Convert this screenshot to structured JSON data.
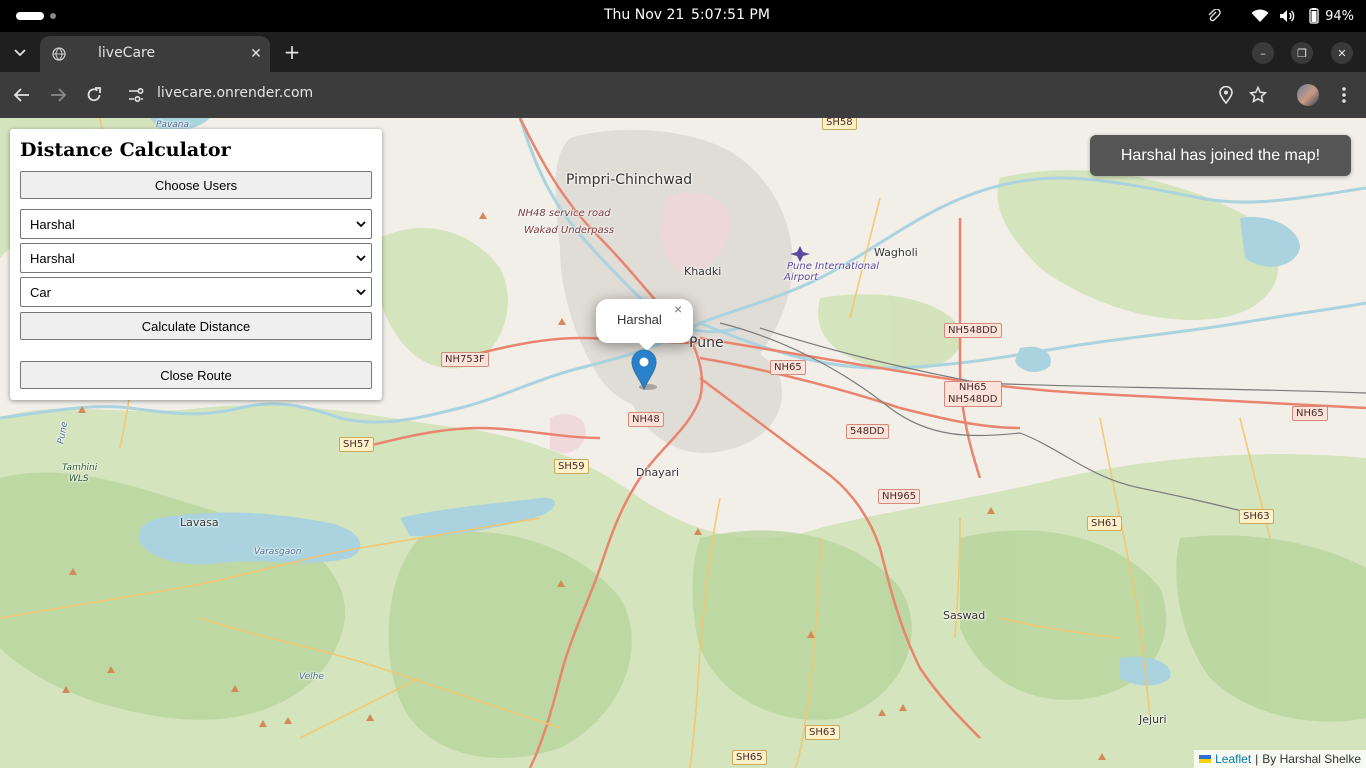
{
  "os": {
    "date": "Thu Nov 21",
    "time": "5:07:51 PM",
    "battery": "94%"
  },
  "browser": {
    "tab_title": "liveCare",
    "url": "livecare.onrender.com"
  },
  "panel": {
    "title": "Distance Calculator",
    "choose_users_label": "Choose Users",
    "user_from_selected": "Harshal",
    "user_to_selected": "Harshal",
    "mode_selected": "Car",
    "calculate_label": "Calculate Distance",
    "close_route_label": "Close Route"
  },
  "popup": {
    "text": "Harshal",
    "close": "×"
  },
  "toast": "Harshal has joined the map!",
  "attribution": {
    "link": "Leaflet",
    "separator": "|",
    "credit": "By Harshal Shelke"
  },
  "map_labels": {
    "pimpri": "Pimpri-Chinchwad",
    "pune": "Pune",
    "khadki": "Khadki",
    "wagholi": "Wagholi",
    "dhayari": "Dhayari",
    "lavasa": "Lavasa",
    "saswad": "Saswad",
    "jejuri": "Jejuri",
    "pavana": "Pavana",
    "varasgaon": "Varasgaon",
    "velhe": "Velhe",
    "tamhini": "Tamhini",
    "wls": "WLS",
    "airport1": "Pune International",
    "airport2": "Airport",
    "nh48_service": "NH48 service road",
    "wakad": "Wakad Underpass",
    "river_pune": "Pune"
  },
  "road_shields": {
    "sh58": "SH58",
    "nh753f": "NH753F",
    "nh548dd_1": "NH548DD",
    "nh65_1": "NH65",
    "nh65_2": "NH65",
    "nh548dd_2": "NH548DD",
    "nh65_3": "NH65",
    "nh48": "NH48",
    "dd548": "548DD",
    "sh57": "SH57",
    "sh59": "SH59",
    "nh965": "NH965",
    "sh61": "SH61",
    "sh63_1": "SH63",
    "sh63_2": "SH63",
    "sh65": "SH65"
  }
}
